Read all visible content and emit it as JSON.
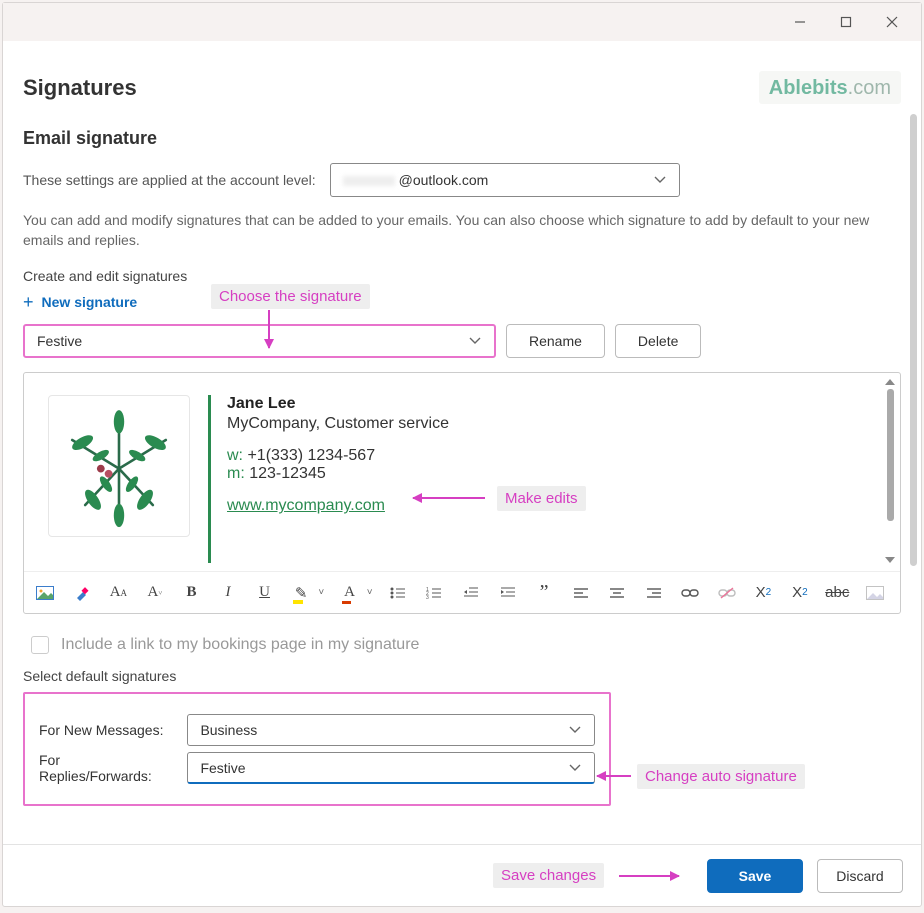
{
  "window": {
    "title": "Signatures"
  },
  "brand": {
    "name1": "Ablebits",
    "name2": ".com"
  },
  "section": {
    "heading": "Email signature",
    "acct_label": "These settings are applied at the account level:",
    "acct_value": "@outlook.com",
    "helper": "You can add and modify signatures that can be added to your emails. You can also choose which signature to add by default to your new emails and replies.",
    "create_label": "Create and edit signatures",
    "new_sig": "New signature",
    "selected_signature": "Festive",
    "rename": "Rename",
    "delete": "Delete"
  },
  "signature_preview": {
    "name": "Jane Lee",
    "company": "MyCompany, Customer service",
    "w_label": "w:",
    "w_val": " +1(333) 1234-567",
    "m_label": "m:",
    "m_val": " 123-12345",
    "url": "www.mycompany.com"
  },
  "toolbar_icons": {
    "image": "image-icon",
    "clearfmt": "clear-format-icon",
    "fontsizeup": "fontsize-up-icon",
    "fontsizedn": "fontsize-down-icon",
    "bold": "B",
    "italic": "I",
    "underline": "U",
    "highlight": "highlight-icon",
    "fontcolor": "A",
    "bullets": "bullets-icon",
    "numbers": "numbers-icon",
    "outdent": "outdent-icon",
    "indent": "indent-icon",
    "quote": "”",
    "alignl": "align-left-icon",
    "alignc": "align-center-icon",
    "alignr": "align-right-icon",
    "link": "link-icon",
    "unlink": "unlink-icon",
    "sup": "X",
    "sub": "X",
    "strike": "abc",
    "insert": "insert-img-icon"
  },
  "bookings_checkbox": "Include a link to my bookings page in my signature",
  "defaults": {
    "heading": "Select default signatures",
    "new_label": "For New Messages:",
    "new_value": "Business",
    "reply_label": "For Replies/Forwards:",
    "reply_value": "Festive"
  },
  "callouts": {
    "choose": "Choose the signature",
    "edits": "Make edits",
    "auto": "Change auto signature",
    "save": "Save changes"
  },
  "footer": {
    "save": "Save",
    "discard": "Discard"
  }
}
